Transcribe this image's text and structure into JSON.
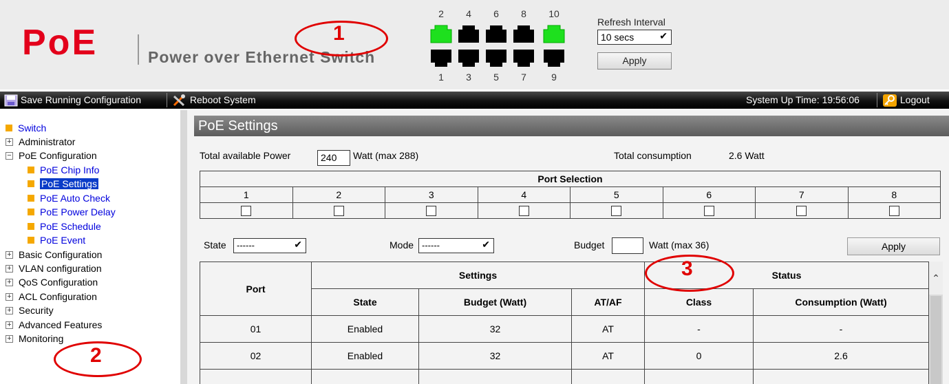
{
  "header": {
    "logo": "PoE",
    "subtitle": "Power over Ethernet Switch",
    "refresh_label": "Refresh Interval",
    "refresh_value": "10 secs",
    "refresh_apply": "Apply",
    "ports_top": [
      "2",
      "4",
      "6",
      "8",
      "10"
    ],
    "ports_bottom": [
      "1",
      "3",
      "5",
      "7",
      "9"
    ],
    "port_active_color": "#1ee01e",
    "port_idle_color": "#000000"
  },
  "toolbar": {
    "save": "Save Running Configuration",
    "reboot": "Reboot System",
    "uptime": "System Up Time: 19:56:06",
    "logout": "Logout"
  },
  "sidebar": {
    "switch": "Switch",
    "administrator": "Administrator",
    "poe_configuration": "PoE Configuration",
    "poe_chip_info": "PoE Chip Info",
    "poe_settings": "PoE Settings",
    "poe_auto_check": "PoE Auto Check",
    "poe_power_delay": "PoE Power Delay",
    "poe_schedule": "PoE Schedule",
    "poe_event": "PoE Event",
    "basic_configuration": "Basic Configuration",
    "vlan_configuration": "VLAN configuration",
    "qos_configuration": "QoS Configuration",
    "acl_configuration": "ACL Configuration",
    "security": "Security",
    "advanced_features": "Advanced Features",
    "monitoring": "Monitoring"
  },
  "main": {
    "title": "PoE Settings",
    "total_power_label": "Total available Power",
    "total_power_value": "240",
    "total_power_unit": "Watt (max 288)",
    "total_consumption_label": "Total consumption",
    "total_consumption_value": "2.6 Watt",
    "port_selection_label": "Port Selection",
    "port_selection": [
      "1",
      "2",
      "3",
      "4",
      "5",
      "6",
      "7",
      "8"
    ],
    "state_label": "State",
    "state_value": "------",
    "mode_label": "Mode",
    "mode_value": "------",
    "budget_label": "Budget",
    "budget_unit": "Watt (max 36)",
    "apply": "Apply",
    "table": {
      "port_header": "Port",
      "settings_header": "Settings",
      "status_header": "Status",
      "col_state": "State",
      "col_budget": "Budget (Watt)",
      "col_atf": "AT/AF",
      "col_class": "Class",
      "col_consumption": "Consumption (Watt)",
      "rows": [
        {
          "port": "01",
          "state": "Enabled",
          "budget": "32",
          "atf": "AT",
          "class": "-",
          "consumption": "-"
        },
        {
          "port": "02",
          "state": "Enabled",
          "budget": "32",
          "atf": "AT",
          "class": "0",
          "consumption": "2.6"
        }
      ]
    }
  },
  "annotations": [
    "1",
    "2",
    "3"
  ]
}
